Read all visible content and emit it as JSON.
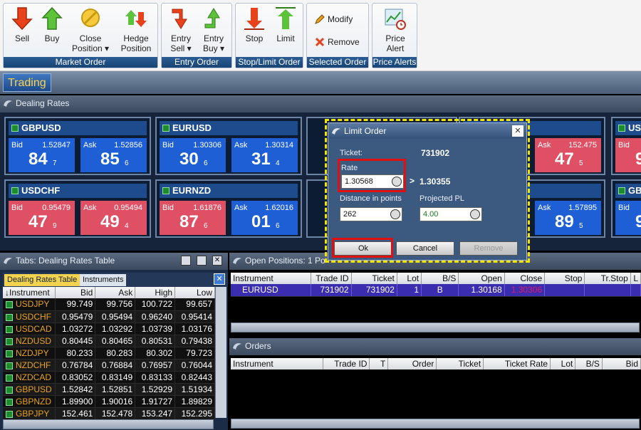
{
  "ribbon": {
    "groups": [
      {
        "caption": "Market Order"
      },
      {
        "caption": "Entry Order"
      },
      {
        "caption": "Stop/Limit Order"
      },
      {
        "caption": "Selected Order"
      },
      {
        "caption": "Price Alerts"
      }
    ],
    "sell": "Sell",
    "buy": "Buy",
    "close_position_1": "Close",
    "close_position_2": "Position ▾",
    "hedge_position_1": "Hedge",
    "hedge_position_2": "Position",
    "entry_sell_1": "Entry",
    "entry_sell_2": "Sell ▾",
    "entry_buy_1": "Entry",
    "entry_buy_2": "Buy ▾",
    "stop": "Stop",
    "limit": "Limit",
    "modify": "Modify",
    "remove": "Remove",
    "price_alert_1": "Price",
    "price_alert_2": "Alert"
  },
  "trading_tab": "Trading",
  "dealing_rates": {
    "title": "Dealing Rates",
    "tiles": [
      {
        "symbol": "GBPUSD",
        "bid_full": "1.52847",
        "bid_big": "84",
        "bid_small": "7",
        "ask_full": "1.52856",
        "ask_big": "85",
        "ask_small": "6",
        "bid_color": "blue",
        "ask_color": "blue"
      },
      {
        "symbol": "EURUSD",
        "bid_full": "1.30306",
        "bid_big": "30",
        "bid_small": "6",
        "ask_full": "1.30314",
        "ask_big": "31",
        "ask_small": "4",
        "bid_color": "blue",
        "ask_color": "blue"
      },
      {
        "symbol": "USDCHF",
        "bid_full": "0.95479",
        "bid_big": "47",
        "bid_small": "9",
        "ask_full": "0.95494",
        "ask_big": "49",
        "ask_small": "4",
        "bid_color": "red",
        "ask_color": "red"
      },
      {
        "symbol": "EURNZD",
        "bid_full": "1.61876",
        "bid_big": "87",
        "bid_small": "6",
        "ask_full": "1.62016",
        "ask_big": "01",
        "ask_small": "6",
        "bid_color": "red",
        "ask_color": "blue"
      }
    ],
    "partial_tiles": [
      {
        "ask_label": "Ask",
        "ask_full": "152.475",
        "ask_big": "47",
        "ask_small": "5",
        "color": "red"
      },
      {
        "ask_label": "Ask",
        "ask_full": "1.57895",
        "ask_big": "89",
        "ask_small": "5",
        "color": "blue"
      }
    ],
    "edge_tiles": [
      {
        "symbol": "US",
        "bid_label": "Bid",
        "big": "9"
      },
      {
        "symbol": "GB",
        "bid_label": "Bid",
        "big": "9"
      }
    ],
    "bid_label": "Bid",
    "ask_label": "Ask"
  },
  "tabs_panel": {
    "title": "Tabs: Dealing Rates Table",
    "tab_active": "Dealing Rates Table",
    "tab_other": "Instruments",
    "columns": [
      "↓Instrument",
      "Bid",
      "Ask",
      "High",
      "Low"
    ],
    "rows": [
      [
        "USDJPY",
        "99.749",
        "99.756",
        "100.722",
        "99.657"
      ],
      [
        "USDCHF",
        "0.95479",
        "0.95494",
        "0.96240",
        "0.95414"
      ],
      [
        "USDCAD",
        "1.03272",
        "1.03292",
        "1.03739",
        "1.03176"
      ],
      [
        "NZDUSD",
        "0.80445",
        "0.80465",
        "0.80531",
        "0.79438"
      ],
      [
        "NZDJPY",
        "80.233",
        "80.283",
        "80.302",
        "79.723"
      ],
      [
        "NZDCHF",
        "0.76784",
        "0.76884",
        "0.76957",
        "0.76044"
      ],
      [
        "NZDCAD",
        "0.83052",
        "0.83149",
        "0.83133",
        "0.82443"
      ],
      [
        "GBPUSD",
        "1.52842",
        "1.52851",
        "1.52929",
        "1.51934"
      ],
      [
        "GBPNZD",
        "1.89900",
        "1.90016",
        "1.91727",
        "1.89829"
      ],
      [
        "GBPJPY",
        "152.461",
        "152.478",
        "153.247",
        "152.295"
      ]
    ]
  },
  "open_positions": {
    "title": "Open Positions: 1 Po",
    "columns": [
      "Instrument",
      "Trade ID",
      "Ticket",
      "Lot",
      "B/S",
      "Open",
      "Close",
      "Stop",
      "Tr.Stop",
      "L"
    ],
    "rows": [
      [
        "EURUSD",
        "731902",
        "731902",
        "1",
        "B",
        "1.30168",
        "1.30306",
        "",
        "",
        ""
      ]
    ]
  },
  "orders": {
    "title": "Orders",
    "columns": [
      "Instrument",
      "Trade ID",
      "T",
      "Order",
      "Ticket",
      "Ticket Rate",
      "Lot",
      "B/S",
      "Bid"
    ]
  },
  "limit_dialog": {
    "title": "Limit Order",
    "ticket_label": "Ticket:",
    "ticket_value": "731902",
    "rate_label": "Rate",
    "rate_value": "1.30568",
    "gt": ">",
    "compare_value": "1.30355",
    "distance_label": "Distance in points",
    "distance_value": "262",
    "projected_label": "Projected PL",
    "projected_value": "4.00",
    "ok": "Ok",
    "cancel": "Cancel",
    "remove": "Remove",
    "close_glyph": "✕"
  },
  "colors": {
    "bid_blue": "#1f5fd6",
    "ask_red": "#e05065",
    "instrument_orange": "#e8a21a",
    "highlight_yellow": "#f5e400",
    "highlight_red": "#e01010",
    "selected_row": "#3a2db0"
  }
}
